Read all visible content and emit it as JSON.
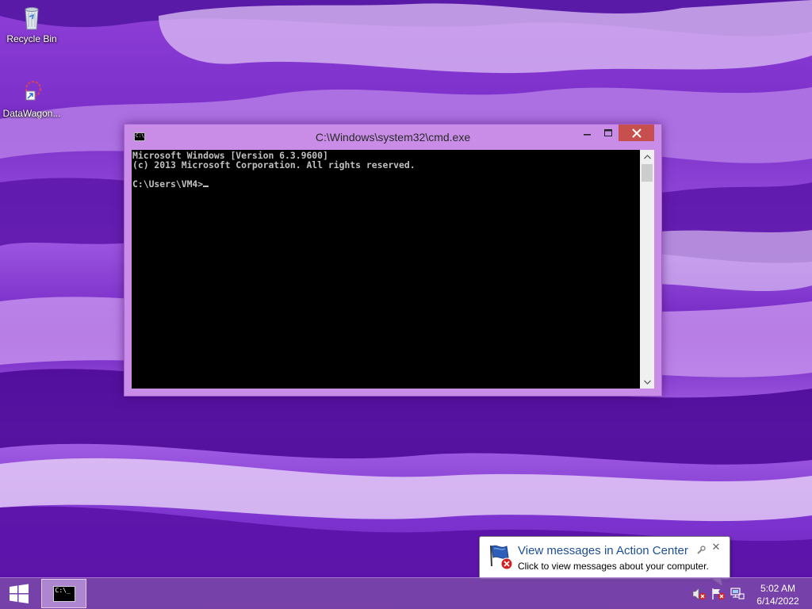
{
  "desktop": {
    "icons": [
      {
        "label": "Recycle Bin",
        "icon": "recycle-bin-icon"
      },
      {
        "label": "DataWagon...",
        "icon": "datawagon-shortcut-icon"
      }
    ]
  },
  "cmd_window": {
    "title": "C:\\Windows\\system32\\cmd.exe",
    "icon": "cmd-icon",
    "icon_text": "C:\\",
    "lines": [
      "Microsoft Windows [Version 6.3.9600]",
      "(c) 2013 Microsoft Corporation. All rights reserved.",
      "",
      "C:\\Users\\VM4>"
    ],
    "close_color": "#c7504f"
  },
  "taskbar": {
    "start_icon": "windows-logo-icon",
    "pinned": [
      {
        "name": "cmd",
        "icon": "cmd-icon",
        "icon_text": "C:\\_"
      }
    ],
    "tray": {
      "icons": [
        "volume-muted-icon",
        "action-center-flag-icon",
        "network-icon"
      ],
      "time": "5:02 AM",
      "date": "6/14/2022"
    }
  },
  "notification": {
    "title": "View messages in Action Center",
    "body": "Click to view messages about your computer.",
    "icon": "action-center-flag-icon",
    "title_color": "#1d4f95"
  }
}
